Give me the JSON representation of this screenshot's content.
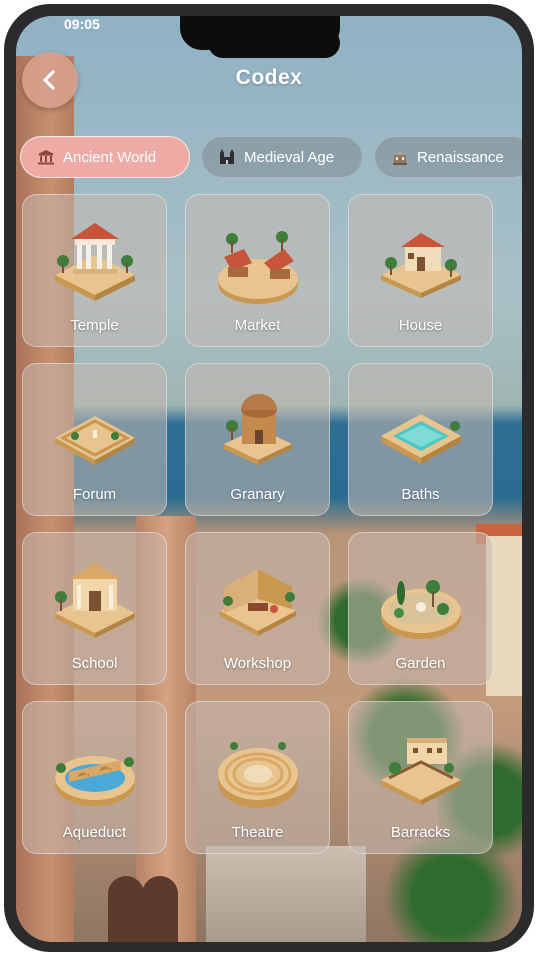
{
  "header": {
    "title": "Codex",
    "status_time": "09:05"
  },
  "tabs": [
    {
      "label": "Ancient World",
      "icon": "temple-icon",
      "active": true
    },
    {
      "label": "Medieval Age",
      "icon": "castle-icon",
      "active": false
    },
    {
      "label": "Renaissance",
      "icon": "palace-icon",
      "active": false
    }
  ],
  "buildings": [
    {
      "label": "Temple",
      "icon": "temple-icon"
    },
    {
      "label": "Market",
      "icon": "market-icon"
    },
    {
      "label": "House",
      "icon": "house-icon"
    },
    {
      "label": "Forum",
      "icon": "forum-icon"
    },
    {
      "label": "Granary",
      "icon": "granary-icon"
    },
    {
      "label": "Baths",
      "icon": "baths-icon"
    },
    {
      "label": "School",
      "icon": "school-icon"
    },
    {
      "label": "Workshop",
      "icon": "workshop-icon"
    },
    {
      "label": "Garden",
      "icon": "garden-icon"
    },
    {
      "label": "Aqueduct",
      "icon": "aqueduct-icon"
    },
    {
      "label": "Theatre",
      "icon": "theatre-icon"
    },
    {
      "label": "Barracks",
      "icon": "barracks-icon"
    }
  ],
  "colors": {
    "active_tab": "#eeaaa5",
    "back_button": "#d7a08c",
    "sand": "#e8c48f",
    "terracotta": "#c8553a"
  }
}
